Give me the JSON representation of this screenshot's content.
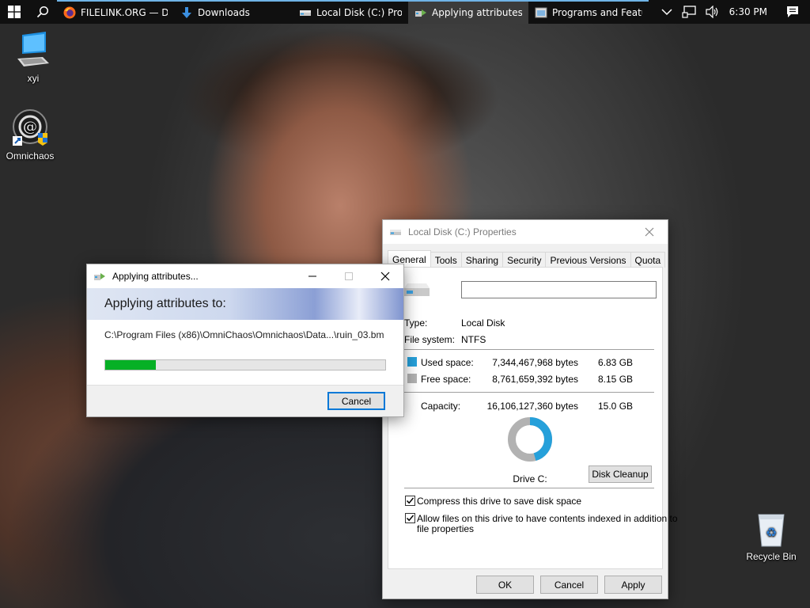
{
  "taskbar": {
    "tasks": [
      {
        "label": "FILELINK.ORG — Do..."
      },
      {
        "label": "Downloads"
      },
      {
        "label": "Local Disk (C:) Prop..."
      },
      {
        "label": "Applying attributes..."
      },
      {
        "label": "Programs and Featu..."
      }
    ],
    "clock": "6:30 PM"
  },
  "desktop": {
    "icons": [
      {
        "label": "xyi"
      },
      {
        "label": "Omnichaos"
      },
      {
        "label": "Recycle Bin"
      }
    ]
  },
  "apply_dialog": {
    "title": "Applying attributes...",
    "heading": "Applying attributes to:",
    "path": "C:\\Program Files (x86)\\OmniChaos\\Omnichaos\\Data...\\ruin_03.bm",
    "progress": 0.18,
    "cancel_label": "Cancel"
  },
  "props_dialog": {
    "title": "Local Disk (C:) Properties",
    "tabs": [
      "General",
      "Tools",
      "Sharing",
      "Security",
      "Previous Versions",
      "Quota"
    ],
    "name_value": "",
    "type_label": "Type:",
    "type_value": "Local Disk",
    "fs_label": "File system:",
    "fs_value": "NTFS",
    "used_label": "Used space:",
    "used_bytes": "7,344,467,968 bytes",
    "used_gb": "6.83 GB",
    "free_label": "Free space:",
    "free_bytes": "8,761,659,392 bytes",
    "free_gb": "8.15 GB",
    "capacity_label": "Capacity:",
    "capacity_bytes": "16,106,127,360 bytes",
    "capacity_gb": "15.0 GB",
    "used_fraction": 0.456,
    "drive_label": "Drive C:",
    "disk_cleanup_label": "Disk Cleanup",
    "compress_label": "Compress this drive to save disk space",
    "compress_checked": true,
    "index_label_line1": "Allow files on this drive to have contents indexed in addition to",
    "index_label_line2": "file properties",
    "index_checked": true,
    "ok_label": "OK",
    "cancel_label": "Cancel",
    "apply_label": "Apply",
    "colors": {
      "used": "#26a0da",
      "free": "#b2b2b2"
    }
  }
}
